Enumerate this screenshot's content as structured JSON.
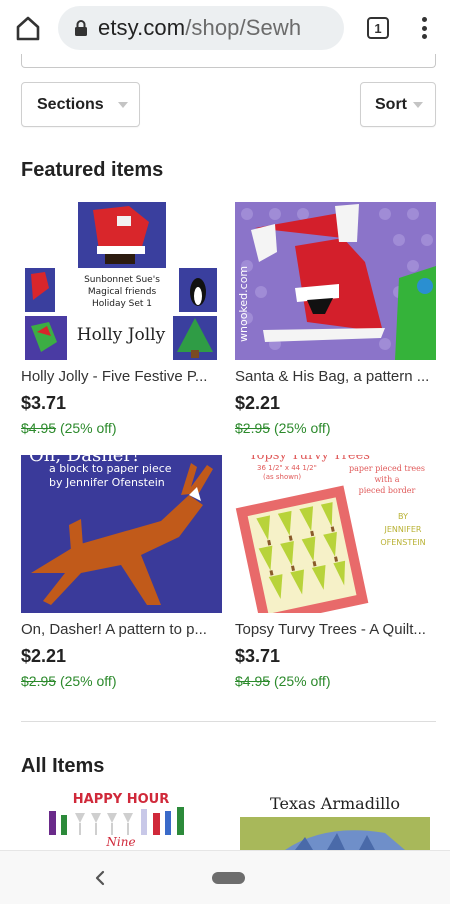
{
  "browser": {
    "url_main": "etsy.com",
    "url_rest": "/shop/Sewh",
    "tab_count": "1"
  },
  "filters": {
    "sections_label": "Sections",
    "sort_label": "Sort"
  },
  "featured": {
    "heading": "Featured items",
    "items": [
      {
        "title": "Holly Jolly - Five Festive P...",
        "price": "$3.71",
        "original_price": "$4.95",
        "discount": "(25% off)",
        "image_texts": [
          "Sunbonnet Sue's",
          "Magical friends",
          "Holiday Set 1",
          "Holly Jolly"
        ]
      },
      {
        "title": "Santa & His Bag, a pattern ...",
        "price": "$2.21",
        "original_price": "$2.95",
        "discount": "(25% off)",
        "image_texts": [
          "wnooked.com"
        ]
      },
      {
        "title": "On, Dasher! A pattern to p...",
        "price": "$2.21",
        "original_price": "$2.95",
        "discount": "(25% off)",
        "image_texts": [
          "On, Dasher!",
          "a block to paper piece",
          "by Jennifer Ofenstein"
        ]
      },
      {
        "title": "Topsy Turvy Trees - A Quilt...",
        "price": "$3.71",
        "original_price": "$4.95",
        "discount": "(25% off)",
        "image_texts": [
          "Topsy Turvy Trees",
          "36 1/2\" x 44 1/2\"",
          "(as shown)",
          "paper pieced trees",
          "with a",
          "pieced border",
          "BY",
          "JENNIFER",
          "OFENSTEIN"
        ]
      }
    ]
  },
  "all_items": {
    "heading": "All Items",
    "previews": [
      {
        "image_texts": [
          "HAPPY HOUR",
          "Nine"
        ]
      },
      {
        "image_texts": [
          "Texas Armadillo"
        ]
      }
    ]
  },
  "colors": {
    "discount_green": "#2c8a2c",
    "url_pill_bg": "#eceff1"
  }
}
